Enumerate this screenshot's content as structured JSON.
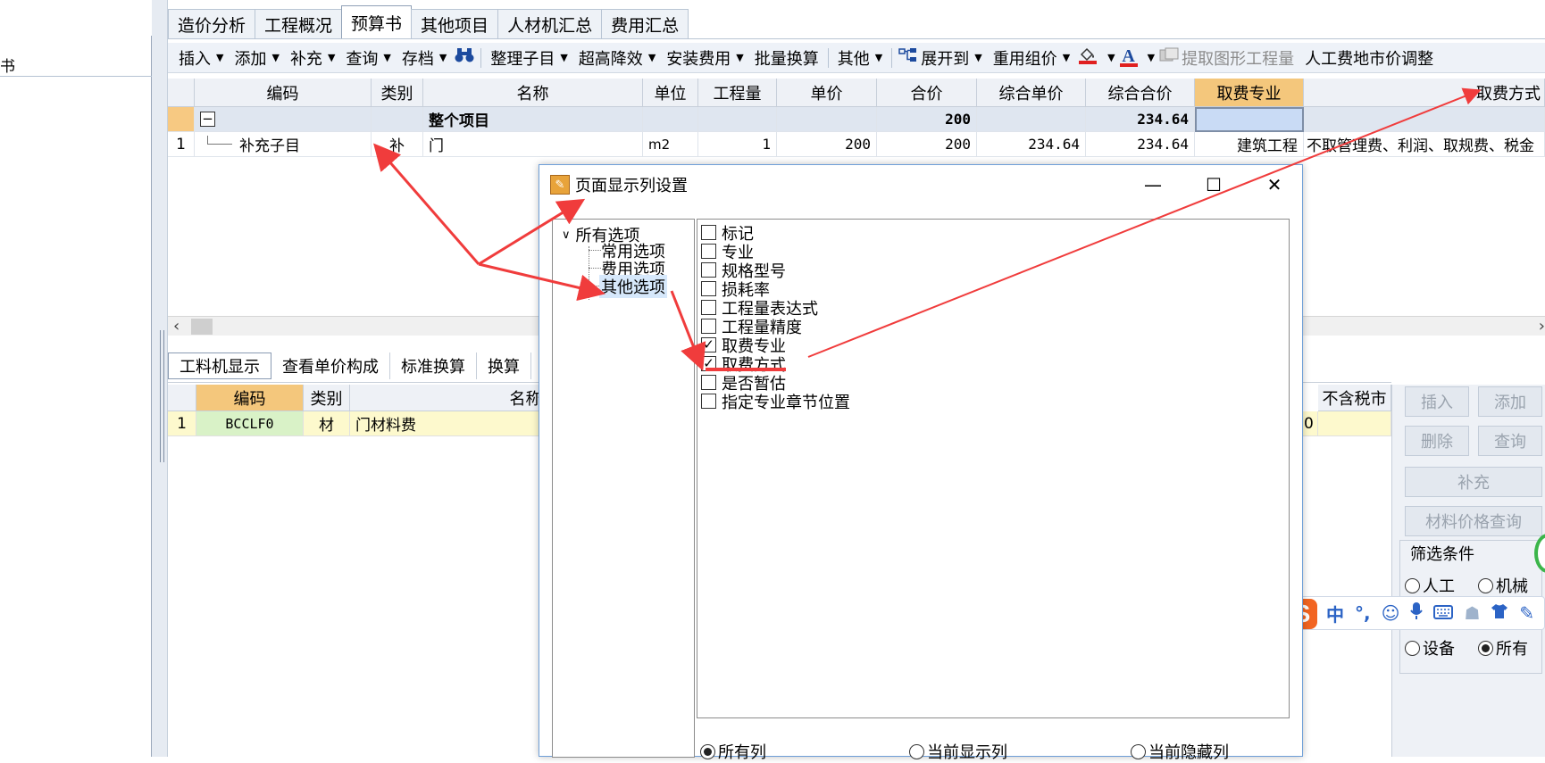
{
  "left_panel": {
    "title": "书"
  },
  "main_tabs": [
    {
      "label": "造价分析"
    },
    {
      "label": "工程概况"
    },
    {
      "label": "预算书"
    },
    {
      "label": "其他项目"
    },
    {
      "label": "人材机汇总"
    },
    {
      "label": "费用汇总"
    }
  ],
  "toolbar": {
    "insert": "插入",
    "add": "添加",
    "supplement": "补充",
    "query": "查询",
    "archive": "存档",
    "organize": "整理子目",
    "super_high": "超高降效",
    "install_fee": "安装费用",
    "batch_convert": "批量换算",
    "other": "其他",
    "expand_to": "展开到",
    "reuse_price": "重用组价",
    "extract_quantity": "提取图形工程量",
    "labor_adjust": "人工费地市价调整",
    "font_letter": "A"
  },
  "grid": {
    "headers": [
      "编码",
      "类别",
      "名称",
      "单位",
      "工程量",
      "单价",
      "合价",
      "综合单价",
      "综合合价",
      "取费专业",
      "取费方式"
    ],
    "summary_row": {
      "expander": "−",
      "name": "整个项目",
      "total": "200",
      "comp_total": "234.64"
    },
    "rows": [
      {
        "index": "1",
        "code": "补充子目",
        "type": "补",
        "name": "门",
        "unit": "m2",
        "qty": "1",
        "price": "200",
        "total": "200",
        "comp_price": "234.64",
        "comp_total": "234.64",
        "fee_major": "建筑工程",
        "fee_method": "不取管理费、利润、取规费、税金"
      }
    ]
  },
  "bottom_tabs": [
    {
      "label": "工料机显示"
    },
    {
      "label": "查看单价构成"
    },
    {
      "label": "标准换算"
    },
    {
      "label": "换算"
    }
  ],
  "bottom_grid": {
    "headers": [
      "编码",
      "类别",
      "名称"
    ],
    "right_header": "不含税市",
    "rows": [
      {
        "index": "1",
        "code": "BCCLF0",
        "type": "材",
        "name": "门材料费",
        "right_value": "0"
      }
    ]
  },
  "right_panel": {
    "insert": "插入",
    "add": "添加",
    "delete": "删除",
    "query": "查询",
    "supplement": "补充",
    "price_query": "材料价格查询",
    "filter_label": "筛选条件",
    "radios": [
      {
        "label": "人工",
        "checked": false
      },
      {
        "label": "机械",
        "checked": false
      },
      {
        "label": "设备",
        "checked": false
      },
      {
        "label": "所有",
        "checked": true
      }
    ]
  },
  "ime": {
    "logo": "S",
    "mode": "中",
    "punct": "°,",
    "icons": [
      "smiley-icon",
      "microphone-icon",
      "keyboard-icon",
      "user-icon",
      "shirt-icon",
      "tool-icon"
    ]
  },
  "dialog": {
    "title": "页面显示列设置",
    "tree": {
      "root": "所有选项",
      "children": [
        "常用选项",
        "费用选项",
        "其他选项"
      ],
      "selected": "其他选项"
    },
    "options": [
      {
        "label": "标记",
        "checked": false
      },
      {
        "label": "专业",
        "checked": false
      },
      {
        "label": "规格型号",
        "checked": false
      },
      {
        "label": "损耗率",
        "checked": false
      },
      {
        "label": "工程量表达式",
        "checked": false
      },
      {
        "label": "工程量精度",
        "checked": false
      },
      {
        "label": "取费专业",
        "checked": true
      },
      {
        "label": "取费方式",
        "checked": true
      },
      {
        "label": "是否暂估",
        "checked": false
      },
      {
        "label": "指定专业章节位置",
        "checked": false
      }
    ],
    "filter_radios": [
      {
        "label": "所有列",
        "checked": true
      },
      {
        "label": "当前显示列",
        "checked": false
      },
      {
        "label": "当前隐藏列",
        "checked": false
      }
    ]
  },
  "colors": {
    "annotation_red": "#f03c3c",
    "header_highlight": "#f4c77c",
    "summary_row": "#dfe6f0",
    "code_green": "#d9f2c7",
    "ime_orange": "#f26522"
  }
}
